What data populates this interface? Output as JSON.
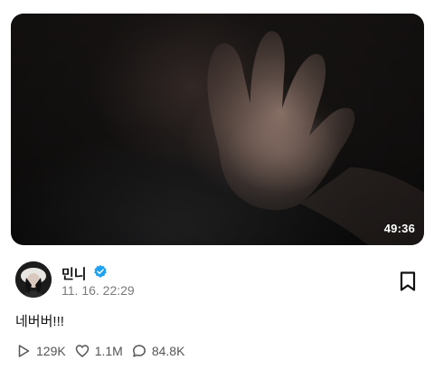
{
  "video": {
    "duration": "49:36"
  },
  "post": {
    "author": "민니",
    "timestamp": "11. 16. 22:29",
    "text": "네버버!!!"
  },
  "stats": {
    "plays": "129K",
    "likes": "1.1M",
    "comments": "84.8K"
  },
  "icons": {
    "play": "play-outline-icon",
    "like": "heart-outline-icon",
    "comment": "comment-bubble-icon",
    "bookmark": "bookmark-icon",
    "verified": "verified-badge-icon"
  },
  "colors": {
    "verified": "#1da1f2",
    "text_primary": "#111111",
    "text_secondary": "#7a7a7a"
  }
}
